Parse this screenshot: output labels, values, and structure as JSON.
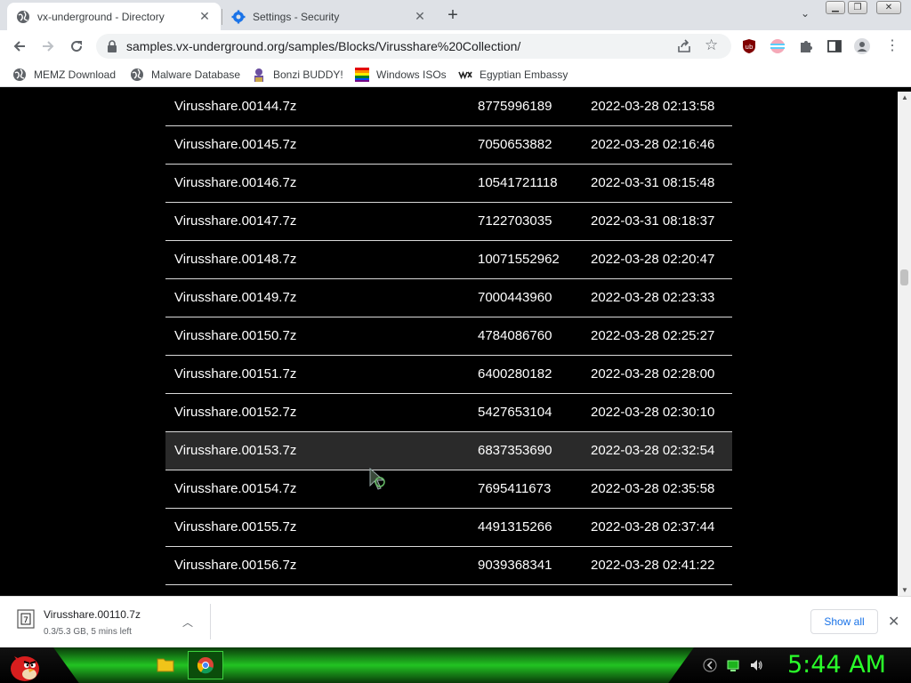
{
  "tabs": [
    {
      "title": "vx-underground - Directory",
      "active": true,
      "icon": "globe-icon"
    },
    {
      "title": "Settings - Security",
      "active": false,
      "icon": "gear-icon"
    }
  ],
  "window_controls": {
    "minimize": "minimize-icon",
    "maximize": "maximize-icon",
    "close": "close-icon"
  },
  "toolbar": {
    "url": "samples.vx-underground.org/samples/Blocks/Virusshare%20Collection/",
    "extensions": [
      "ublock-icon",
      "translate-icon",
      "puzzle-icon",
      "side-panel-icon",
      "profile-icon"
    ]
  },
  "bookmarks": [
    {
      "label": "MEMZ Download",
      "icon": "globe-icon"
    },
    {
      "label": "Malware Database",
      "icon": "globe-icon"
    },
    {
      "label": "Bonzi BUDDY!",
      "icon": "bonzi-icon"
    },
    {
      "label": "Windows ISOs",
      "icon": "windows-icon"
    },
    {
      "label": "Egyptian Embassy",
      "icon": "wix-icon"
    }
  ],
  "files": [
    {
      "name": "Virusshare.00144.7z",
      "size": "8775996189",
      "date": "2022-03-28 02:13:58"
    },
    {
      "name": "Virusshare.00145.7z",
      "size": "7050653882",
      "date": "2022-03-28 02:16:46"
    },
    {
      "name": "Virusshare.00146.7z",
      "size": "10541721118",
      "date": "2022-03-31 08:15:48"
    },
    {
      "name": "Virusshare.00147.7z",
      "size": "7122703035",
      "date": "2022-03-31 08:18:37"
    },
    {
      "name": "Virusshare.00148.7z",
      "size": "10071552962",
      "date": "2022-03-28 02:20:47"
    },
    {
      "name": "Virusshare.00149.7z",
      "size": "7000443960",
      "date": "2022-03-28 02:23:33"
    },
    {
      "name": "Virusshare.00150.7z",
      "size": "4784086760",
      "date": "2022-03-28 02:25:27"
    },
    {
      "name": "Virusshare.00151.7z",
      "size": "6400280182",
      "date": "2022-03-28 02:28:00"
    },
    {
      "name": "Virusshare.00152.7z",
      "size": "5427653104",
      "date": "2022-03-28 02:30:10"
    },
    {
      "name": "Virusshare.00153.7z",
      "size": "6837353690",
      "date": "2022-03-28 02:32:54"
    },
    {
      "name": "Virusshare.00154.7z",
      "size": "7695411673",
      "date": "2022-03-28 02:35:58"
    },
    {
      "name": "Virusshare.00155.7z",
      "size": "4491315266",
      "date": "2022-03-28 02:37:44"
    },
    {
      "name": "Virusshare.00156.7z",
      "size": "9039368341",
      "date": "2022-03-28 02:41:22"
    }
  ],
  "download": {
    "filename": "Virusshare.00110.7z",
    "status": "0.3/5.3 GB, 5 mins left",
    "show_all": "Show all"
  },
  "taskbar": {
    "clock": "5:44 AM"
  },
  "colors": {
    "page_bg": "#000000",
    "row_text": "#ffffff",
    "row_divider": "#d9d9d9",
    "clock": "#2aff2a",
    "taskbar_glow": "#22c322",
    "link_blue": "#1a73e8"
  }
}
